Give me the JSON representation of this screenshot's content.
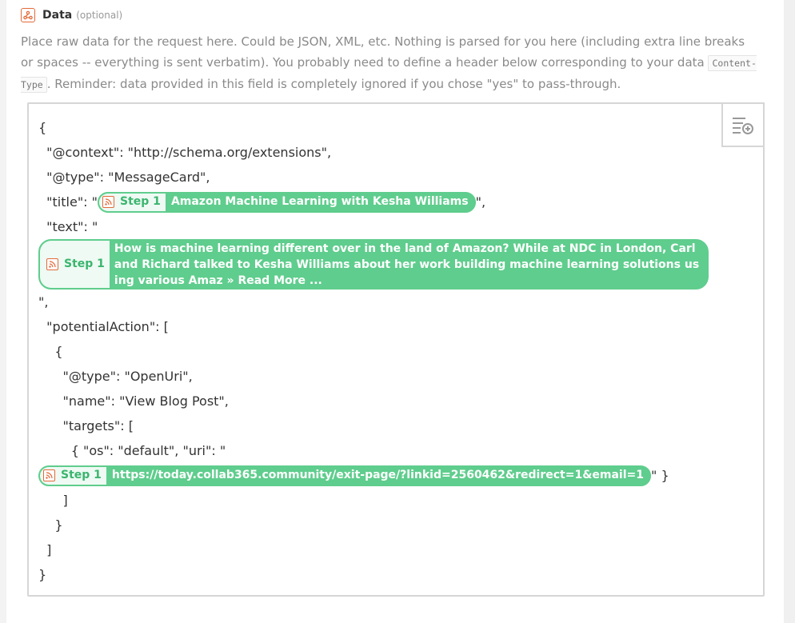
{
  "field": {
    "label": "Data",
    "optional": "(optional)",
    "help_before": "Place raw data for the request here. Could be JSON, XML, etc. Nothing is parsed for you here (including extra line breaks or spaces -- everything is sent verbatim). You probably need to define a header below corresponding to your data ",
    "help_code": "Content-Type",
    "help_after": ". Reminder: data provided in this field is completely ignored if you chose \"yes\" to pass-through."
  },
  "editor": {
    "insert_button_icon": "insert-field-icon",
    "lines": {
      "l1": "{",
      "l2": "  \"@context\": \"http://schema.org/extensions\",",
      "l3": "  \"@type\": \"MessageCard\",",
      "l4_pre": "  \"title\": \"",
      "l4_post": "\",",
      "l5": "  \"text\": \"",
      "l7": "\",",
      "l8": "  \"potentialAction\": [",
      "l9": "    {",
      "l10": "      \"@type\": \"OpenUri\",",
      "l11": "      \"name\": \"View Blog Post\",",
      "l12": "      \"targets\": [",
      "l13": "        { \"os\": \"default\", \"uri\": \"",
      "l14_post": "\" }",
      "l15": "      ]",
      "l16": "    }",
      "l17": "  ]",
      "l18": "}"
    },
    "pills": {
      "title": {
        "step": "Step 1",
        "value": "Amazon Machine Learning with Kesha Williams"
      },
      "text": {
        "step": "Step 1",
        "value": "How is machine learning different over in the land of Amazon? While at NDC in London, Carl and Richard talked to Kesha Williams about her work building machine learning solutions using various Amaz » Read More ..."
      },
      "uri": {
        "step": "Step 1",
        "value": "https://today.collab365.community/exit-page/?linkid=2560462&redirect=1&email=1"
      }
    }
  },
  "colors": {
    "pill_green": "#5fcd8d",
    "rss_orange": "#e36a3a"
  }
}
